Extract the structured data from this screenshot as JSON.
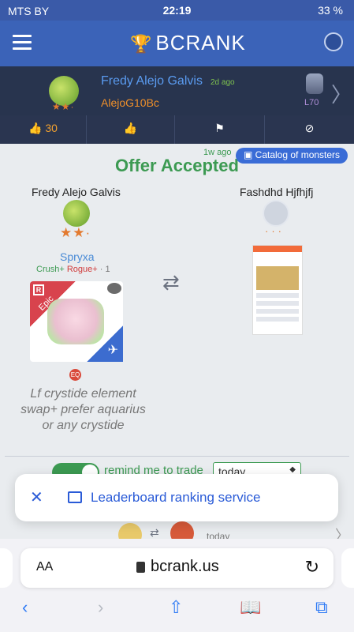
{
  "status_bar": {
    "carrier": "MTS BY",
    "time": "22:19",
    "battery": "33 %"
  },
  "app": {
    "brand": "BCRANK",
    "menu_icon": "hamburger-icon",
    "globe_icon": "globe-icon",
    "trophy_icon": "trophy-icon"
  },
  "profile": {
    "name": "Fredy Alejo Galvis",
    "ago": "2d ago",
    "handle": "AlejoG10Bc",
    "stars": "★★·",
    "level": "L70",
    "next_arrow": "〉"
  },
  "actions": {
    "like_count": "30",
    "like_icon": "👍",
    "thumb_icon": "👍",
    "flag_icon": "⚑",
    "block_icon": "⊘"
  },
  "offer": {
    "title": "Offer Accepted",
    "ago": "1w ago",
    "catalog_label": "Catalog of monsters",
    "left_user": {
      "name": "Fredy Alejo Galvis",
      "stars": "★★·"
    },
    "right_user": {
      "name": "Fashdhd Hjfhjfj",
      "stars": "···"
    },
    "monster": {
      "name": "Spryxa",
      "tag1": "Crush+",
      "tag2": "Rogue+",
      "count": "· 1",
      "rarity": "Epic",
      "rarity_mark": "R"
    },
    "eq_label": "EQ",
    "note": "Lf crystide element swap+ prefer aquarius or any crystide",
    "swap_icon": "⇄"
  },
  "reminder": {
    "label": "remind me to trade",
    "when": "today",
    "enabled": true
  },
  "toast": {
    "label": "Leaderboard ranking service",
    "close": "✕"
  },
  "next_offer": {
    "when": "today",
    "arrow": "〉"
  },
  "browser": {
    "aa_label": "AA",
    "url": "bcrank.us",
    "reload": "↻",
    "back": "‹",
    "forward": "›",
    "share": "⇧",
    "bookmarks": "📖",
    "tabs": "⧉"
  }
}
